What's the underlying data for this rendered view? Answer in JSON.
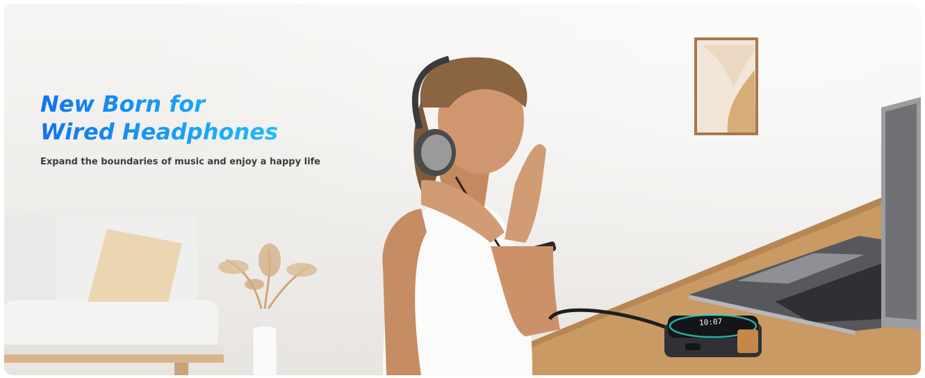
{
  "hero": {
    "headline_line1": "New Born for",
    "headline_line2": "Wired Headphones",
    "tagline": "Expand the boundaries of music and enjoy a happy life"
  },
  "colors": {
    "headline_start": "#1273f0",
    "headline_end": "#23c9f5",
    "tagline": "#3d3d3d",
    "desk_wood": "#c99a63",
    "laptop": "#8d8f94"
  },
  "device_display": {
    "time": "10:07"
  }
}
